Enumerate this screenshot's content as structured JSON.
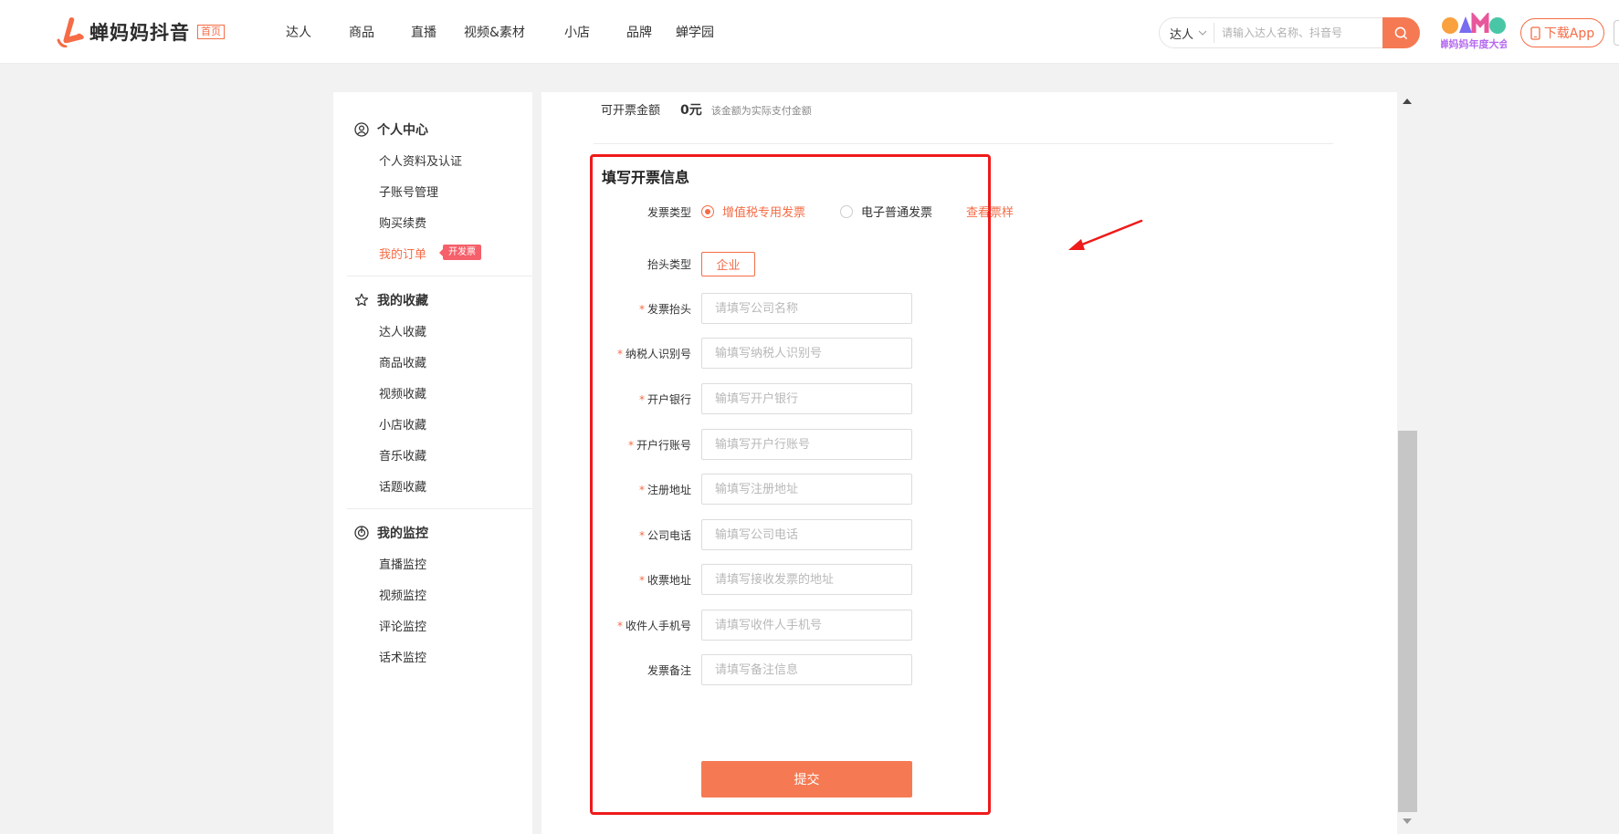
{
  "header": {
    "logo_text": "蝉妈妈抖音",
    "logo_tag": "首页",
    "nav": [
      "达人",
      "商品",
      "直播",
      "视频&素材",
      "小店",
      "品牌",
      "蝉学园"
    ],
    "search_type": "达人",
    "search_placeholder": "请输入达人名称、抖音号",
    "gmg_text": "蝉妈妈年度大会",
    "download_label": "下载App",
    "accent": "#f56c46"
  },
  "sidebar": {
    "sections": [
      {
        "title": "个人中心",
        "icon": "user-circle-icon",
        "items": [
          "个人资料及认证",
          "子账号管理",
          "购买续费",
          "我的订单"
        ]
      },
      {
        "title": "我的收藏",
        "icon": "star-icon",
        "items": [
          "达人收藏",
          "商品收藏",
          "视频收藏",
          "小店收藏",
          "音乐收藏",
          "话题收藏"
        ]
      },
      {
        "title": "我的监控",
        "icon": "monitor-icon",
        "items": [
          "直播监控",
          "视频监控",
          "评论监控",
          "话术监控"
        ]
      }
    ],
    "active_item": "我的订单",
    "badge": "开发票"
  },
  "main": {
    "amount_label": "可开票金额",
    "amount_value": "0元",
    "amount_note": "该金额为实际支付金额",
    "form_title": "填写开票信息",
    "invoice_type_label": "发票类型",
    "invoice_type_options": [
      "增值税专用发票",
      "电子普通发票"
    ],
    "invoice_type_selected": "增值税专用发票",
    "sample_link": "查看票样",
    "title_type_label": "抬头类型",
    "title_type_value": "企业",
    "fields": [
      {
        "label": "发票抬头",
        "required": "*",
        "placeholder": "请填写公司名称"
      },
      {
        "label": "纳税人识别号",
        "required": "*",
        "placeholder": "输填写纳税人识别号"
      },
      {
        "label": "开户银行",
        "required": "*",
        "placeholder": "输填写开户银行"
      },
      {
        "label": "开户行账号",
        "required": "*",
        "placeholder": "输填写开户行账号"
      },
      {
        "label": "注册地址",
        "required": "*",
        "placeholder": "输填写注册地址"
      },
      {
        "label": "公司电话",
        "required": "*",
        "placeholder": "输填写公司电话"
      },
      {
        "label": "收票地址",
        "required": "*",
        "placeholder": "请填写接收发票的地址"
      },
      {
        "label": "收件人手机号",
        "required": "*",
        "placeholder": "请填写收件人手机号"
      },
      {
        "label": "发票备注",
        "required": "",
        "placeholder": "请填写备注信息"
      }
    ],
    "submit_label": "提交"
  }
}
